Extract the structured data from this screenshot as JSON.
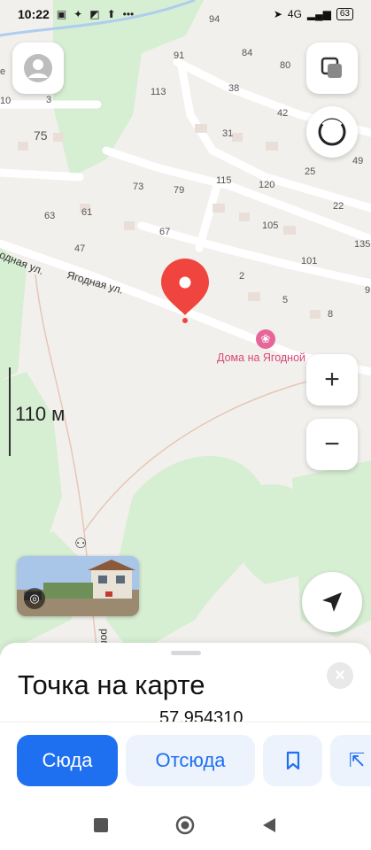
{
  "status_bar": {
    "time": "10:22",
    "notification_icons": [
      "nfc-icon",
      "dropbox-icon",
      "photo-icon",
      "upload-icon"
    ],
    "more": "•••",
    "network": "4G",
    "battery": "63"
  },
  "map": {
    "street_name": "Ягодная ул.",
    "street_name_partial": "одная ул.",
    "road_label_bottom": "рога",
    "poi_name": "Дома на Ягодной",
    "house_numbers": [
      "94",
      "91",
      "84",
      "80",
      "113",
      "38",
      "42",
      "31",
      "49",
      "25",
      "22",
      "115",
      "120",
      "73",
      "79",
      "61",
      "63",
      "67",
      "105",
      "135",
      "101",
      "47",
      "2",
      "5",
      "8",
      "3",
      "75",
      "e",
      "10",
      "9"
    ],
    "scale_label": "110 м",
    "colors": {
      "land": "#f2f0ec",
      "green": "#d6eed2",
      "road": "#ffffff",
      "pin": "#f0443e",
      "poi": "#d9487c"
    }
  },
  "sheet": {
    "title": "Точка на карте",
    "coordinates": "57.954310"
  },
  "actions": {
    "here_label": "Сюда",
    "from_label": "Отсюда"
  }
}
